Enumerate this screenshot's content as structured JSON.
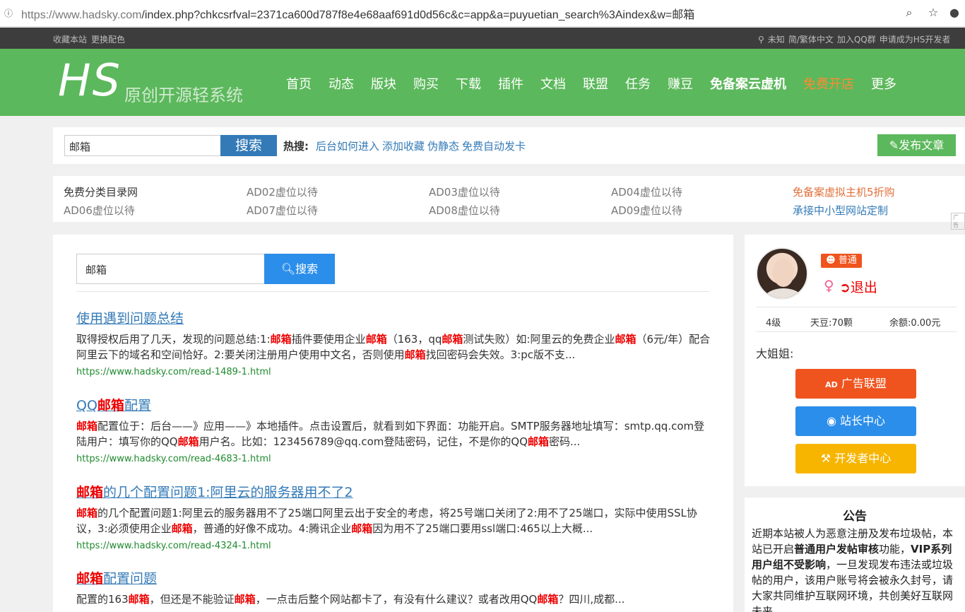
{
  "browser": {
    "url_prefix": "https://www.hadsky.com",
    "url_rest": "/index.php?chkcsrfval=2371ca600d787f8e4e68aaf691d0d56c&c=app&a=puyuetian_search%3Aindex&w=邮箱"
  },
  "topbar": {
    "left": [
      "收藏本站",
      "更换配色"
    ],
    "right": [
      "未知",
      "简/繁体中文",
      "加入QQ群",
      "申请成为HS开发者"
    ]
  },
  "header": {
    "logo": "HS",
    "logo_sub": "原创开源轻系统",
    "nav": [
      "首页",
      "动态",
      "版块",
      "购买",
      "下载",
      "插件",
      "文档",
      "联盟",
      "任务",
      "赚豆"
    ],
    "nav_bold": "免备案云虚机",
    "nav_hot": "免费开店",
    "nav_more": "更多"
  },
  "searchbar": {
    "value": "邮箱",
    "button": "搜索",
    "hot_label": "热搜:",
    "hot_links": [
      "后台如何进入",
      "添加收藏",
      "伪静态",
      "免费自动发卡"
    ],
    "post_button": "发布文章"
  },
  "ads": {
    "row1": [
      "免费分类目录网",
      "AD02虚位以待",
      "AD03虚位以待",
      "AD04虚位以待",
      "免备案虚拟主机5折购"
    ],
    "row2": [
      "AD06虚位以待",
      "AD07虚位以待",
      "AD08虚位以待",
      "AD09虚位以待",
      "承接中小型网站定制"
    ],
    "tag": "广告"
  },
  "main_search": {
    "value": "邮箱",
    "button": "搜索"
  },
  "results": [
    {
      "title": [
        {
          "t": "使用遇到问题总结"
        }
      ],
      "desc": [
        {
          "t": "取得授权后用了几天，发现的问题总结:1:"
        },
        {
          "t": "邮箱",
          "h": true
        },
        {
          "t": "插件要使用企业"
        },
        {
          "t": "邮箱",
          "h": true
        },
        {
          "t": "（163，qq"
        },
        {
          "t": "邮箱",
          "h": true
        },
        {
          "t": "测试失败）如:阿里云的免费企业"
        },
        {
          "t": "邮箱",
          "h": true
        },
        {
          "t": "（6元/年）配合阿里云下的域名和空间恰好。2:要关闭注册用户使用中文名，否则使用"
        },
        {
          "t": "邮箱",
          "h": true
        },
        {
          "t": "找回密码会失效。3:pc版不支..."
        }
      ],
      "url": "https://www.hadsky.com/read-1489-1.html"
    },
    {
      "title": [
        {
          "t": "QQ"
        },
        {
          "t": "邮箱",
          "h": true
        },
        {
          "t": "配置"
        }
      ],
      "desc": [
        {
          "t": "邮箱",
          "h": true
        },
        {
          "t": "配置位于：后台——》应用——》本地插件。点击设置后，就看到如下界面：功能开启。SMTP服务器地址填写：smtp.qq.com登陆用户：填写你的QQ"
        },
        {
          "t": "邮箱",
          "h": true
        },
        {
          "t": "用户名。比如：123456789@qq.com登陆密码，记住，不是你的QQ"
        },
        {
          "t": "邮箱",
          "h": true
        },
        {
          "t": "密码..."
        }
      ],
      "url": "https://www.hadsky.com/read-4683-1.html"
    },
    {
      "title": [
        {
          "t": "邮箱",
          "h": true
        },
        {
          "t": "的几个配置问题1:阿里云的服务器用不了2"
        }
      ],
      "desc": [
        {
          "t": "邮箱",
          "h": true
        },
        {
          "t": "的几个配置问题1:阿里云的服务器用不了25端口阿里云出于安全的考虑，将25号端口关闭了2:用不了25端口，实际中使用SSL协议，3:必须使用企业"
        },
        {
          "t": "邮箱",
          "h": true
        },
        {
          "t": "，普通的好像不成功。4:腾讯企业"
        },
        {
          "t": "邮箱",
          "h": true
        },
        {
          "t": "因为用不了25端口要用ssl端口:465以上大概..."
        }
      ],
      "url": "https://www.hadsky.com/read-4324-1.html"
    },
    {
      "title": [
        {
          "t": "邮箱",
          "h": true
        },
        {
          "t": "配置问题"
        }
      ],
      "desc": [
        {
          "t": "配置的163"
        },
        {
          "t": "邮箱",
          "h": true
        },
        {
          "t": "，但还是不能验证"
        },
        {
          "t": "邮箱",
          "h": true
        },
        {
          "t": "，一点击后整个网站都卡了，有没有什么建议？或者改用QQ"
        },
        {
          "t": "邮箱",
          "h": true
        },
        {
          "t": "？四川,成都..."
        }
      ],
      "url": ""
    }
  ],
  "user": {
    "badge": "普通",
    "logout": "退出",
    "level": "4级",
    "beans": "天豆:70颗",
    "balance": "余额:0.00元",
    "nickname": "大姐姐:",
    "buttons": {
      "ad_union": "广告联盟",
      "webmaster": "站长中心",
      "developer": "开发者中心"
    },
    "colors": {
      "ad_union": "#f0541e",
      "webmaster": "#2b8eea",
      "developer": "#f7b500"
    }
  },
  "notice": {
    "title": "公告",
    "body": [
      {
        "t": "近期本站被人为恶意注册及发布垃圾帖，本站已开启"
      },
      {
        "t": "普通用户发帖审核",
        "b": true
      },
      {
        "t": "功能，"
      },
      {
        "t": "VIP系列用户组不受影响",
        "b": true
      },
      {
        "t": "，一旦发现发布违法或垃圾帖的用户，该用户账号将会被永久封号，请大家共同维护互联网环境，共创美好互联网未来。"
      }
    ]
  }
}
